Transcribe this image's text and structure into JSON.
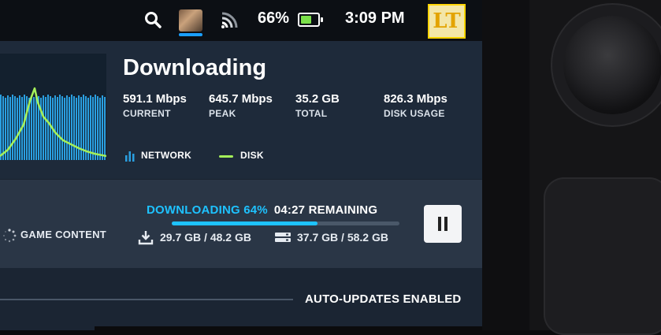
{
  "status_bar": {
    "battery_percent": "66%",
    "battery_level": 0.66,
    "time": "3:09 PM",
    "profile_initials": "LT"
  },
  "download": {
    "title": "Downloading",
    "stats": [
      {
        "value": "591.1 Mbps",
        "label": "CURRENT"
      },
      {
        "value": "645.7 Mbps",
        "label": "PEAK"
      },
      {
        "value": "35.2 GB",
        "label": "TOTAL"
      },
      {
        "value": "826.3 Mbps",
        "label": "DISK USAGE"
      }
    ],
    "legend": {
      "network": "NETWORK",
      "disk": "DISK"
    }
  },
  "active": {
    "game_content_label": "GAME CONTENT",
    "status_label": "DOWNLOADING 64%",
    "remaining": "04:27 REMAINING",
    "progress": 0.64,
    "downloaded": "29.7 GB",
    "download_total": "48.2 GB",
    "disk_written": "37.7 GB",
    "disk_total": "58.2 GB",
    "separator": "/"
  },
  "footer": {
    "auto_updates": "AUTO-UPDATES ENABLED"
  },
  "colors": {
    "accent": "#1ec2ff",
    "network_bar": "#2a9fe0",
    "disk_line": "#a5f05a",
    "battery_fill": "#7be04a"
  }
}
